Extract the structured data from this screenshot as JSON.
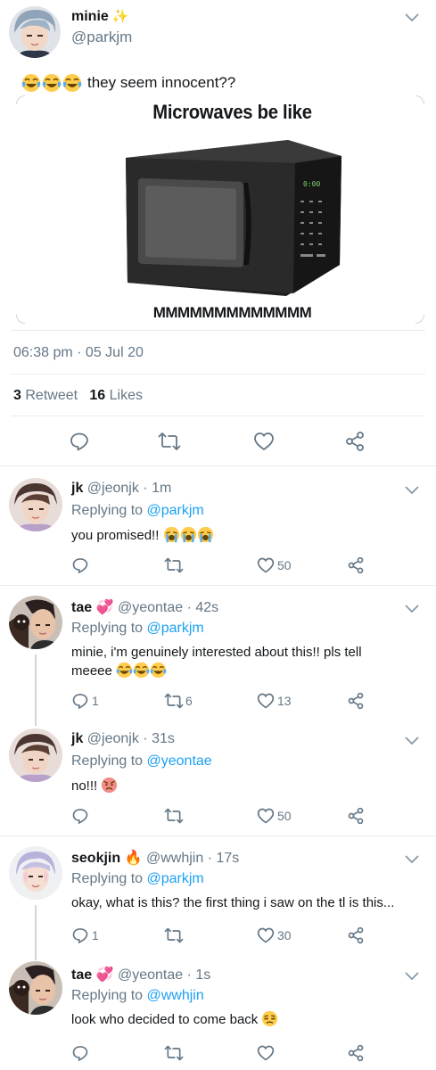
{
  "main_tweet": {
    "name": "minie",
    "sparkle": "✨",
    "handle": "@parkjm",
    "text": "they seem innocent??",
    "meme_title": "Microwaves be like",
    "meme_bottom": "MMMMMMMMMMMMM",
    "microwave_display": "0:00",
    "timestamp": "06:38 pm · 05 Jul 20",
    "retweets": "3",
    "retweet_label": "Retweet",
    "likes": "16",
    "likes_label": "Likes"
  },
  "replies": [
    {
      "name": "jk",
      "handle": "@jeonjk",
      "time": "· 1m",
      "replying_prefix": "Replying to",
      "replying_to": "@parkjm",
      "text": "you promised!!",
      "emoji": "crying-face",
      "reply_count": "",
      "retweet_count": "",
      "like_count": "50"
    },
    {
      "name": "tae",
      "badge": "💞",
      "handle": "@yeontae",
      "time": "· 42s",
      "replying_prefix": "Replying to",
      "replying_to": "@parkjm",
      "text": "minie, i'm genuinely interested about this!! pls tell meeee",
      "emoji": "joy-face",
      "reply_count": "1",
      "retweet_count": "6",
      "like_count": "13"
    },
    {
      "name": "jk",
      "handle": "@jeonjk",
      "time": "· 31s",
      "replying_prefix": "Replying to",
      "replying_to": "@yeontae",
      "text": "no!!!",
      "emoji": "angry-face",
      "reply_count": "",
      "retweet_count": "",
      "like_count": "50"
    },
    {
      "name": "seokjin",
      "badge": "🔥",
      "handle": "@wwhjin",
      "time": "· 17s",
      "replying_prefix": "Replying to",
      "replying_to": "@parkjm",
      "text": "okay, what is this? the first thing i saw on the tl is this...",
      "reply_count": "1",
      "retweet_count": "",
      "like_count": "30"
    },
    {
      "name": "tae",
      "badge": "💞",
      "handle": "@yeontae",
      "time": "· 1s",
      "replying_prefix": "Replying to",
      "replying_to": "@wwhjin",
      "text": "look who decided to come back",
      "emoji": "unamused-face",
      "reply_count": "",
      "retweet_count": "",
      "like_count": ""
    }
  ],
  "icons": {
    "reply": "reply-icon",
    "retweet": "retweet-icon",
    "like": "heart-icon",
    "share": "share-icon",
    "more": "chevron-down-icon"
  },
  "colors": {
    "link": "#1da1f2",
    "muted": "#657786",
    "text": "#14171a",
    "divider": "#e6ecf0"
  }
}
